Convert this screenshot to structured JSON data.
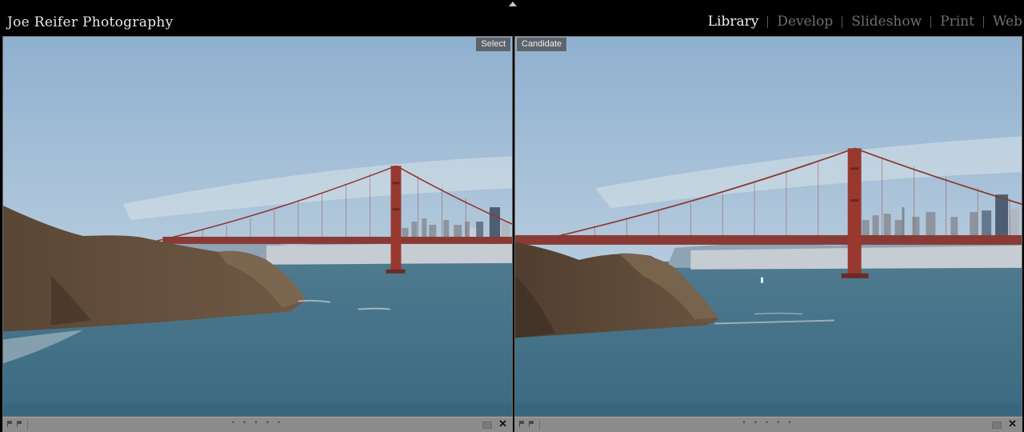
{
  "header": {
    "identity_plate": "Joe Reifer Photography",
    "modules": [
      "Library",
      "Develop",
      "Slideshow",
      "Print",
      "Web"
    ],
    "active_module": "Library"
  },
  "compare": {
    "left": {
      "label": "Select"
    },
    "right": {
      "label": "Candidate"
    }
  },
  "toolbar": {
    "rating_dots": "• • • • •",
    "close_glyph": "✕"
  },
  "icons": [
    "collapse-top-panel-icon",
    "flag-pick-icon",
    "flag-reject-icon",
    "color-label-icon",
    "close-icon"
  ]
}
